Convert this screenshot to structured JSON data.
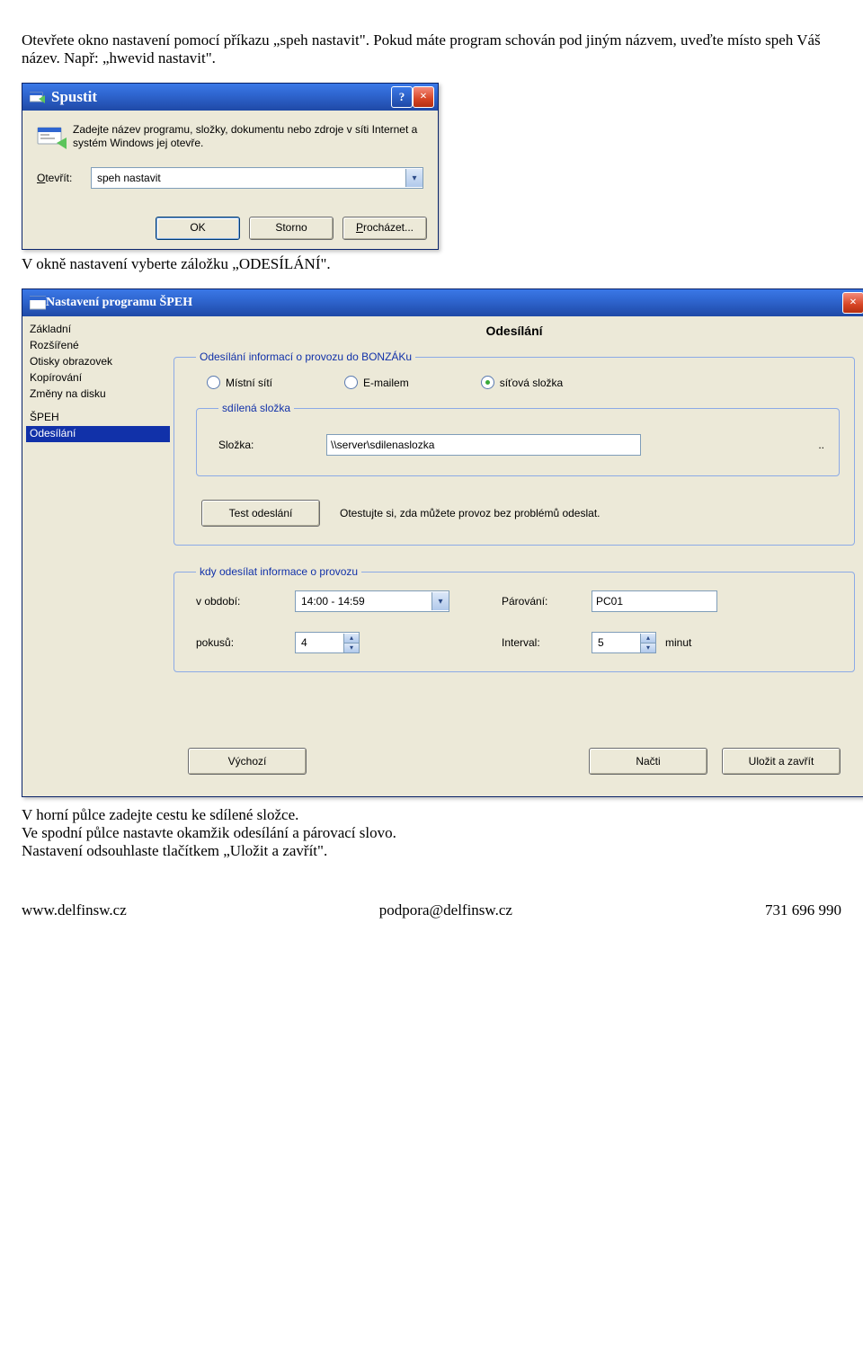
{
  "doc": {
    "para1": "Otevřete okno nastavení pomocí příkazu „speh nastavit\". Pokud máte program schován pod jiným názvem, uveďte místo speh Váš název. Např: „hwevid nastavit\".",
    "para2": "V okně nastavení vyberte záložku „ODESÍLÁNÍ\".",
    "para3": "V horní půlce zadejte cestu ke sdílené složce.",
    "para4": "Ve spodní půlce nastavte okamžik odesílání a párovací slovo.",
    "para5": "Nastavení odsouhlaste tlačítkem „Uložit a zavřít\"."
  },
  "run": {
    "title": "Spustit",
    "desc": "Zadejte název programu, složky, dokumentu nebo zdroje v síti Internet a systém Windows jej otevře.",
    "open_label": "Otevřít:",
    "input_value": "speh nastavit",
    "ok": "OK",
    "cancel": "Storno",
    "browse": "Procházet..."
  },
  "settings": {
    "title": "Nastavení programu ŠPEH",
    "sidebar": [
      "Základní",
      "Rozšířené",
      "Otisky obrazovek",
      "Kopírování",
      "Změny na disku"
    ],
    "sidebar2": [
      "ŠPEH",
      "Odesílání"
    ],
    "heading": "Odesílání",
    "group1_legend": "Odesílání informací o provozu do BONZÁKu",
    "radio_local": "Místní sítí",
    "radio_email": "E-mailem",
    "radio_share": "síťová složka",
    "group_share_legend": "sdílená složka",
    "folder_label": "Složka:",
    "folder_value": "\\\\server\\sdilenaslozka",
    "dots": "..",
    "test_button": "Test odeslání",
    "test_desc": "Otestujte si, zda můžete provoz bez problémů odeslat.",
    "group2_legend": "kdy odesílat informace o provozu",
    "period_label": "v období:",
    "period_value": "14:00 - 14:59",
    "pair_label": "Párování:",
    "pair_value": "PC01",
    "tries_label": "pokusů:",
    "tries_value": "4",
    "interval_label": "Interval:",
    "interval_value": "5",
    "minutes_label": "minut",
    "btn_default": "Výchozí",
    "btn_load": "Načti",
    "btn_save": "Uložit a zavřít"
  },
  "footer": {
    "left": "www.delfinsw.cz",
    "center": "podpora@delfinsw.cz",
    "right": "731 696 990"
  }
}
